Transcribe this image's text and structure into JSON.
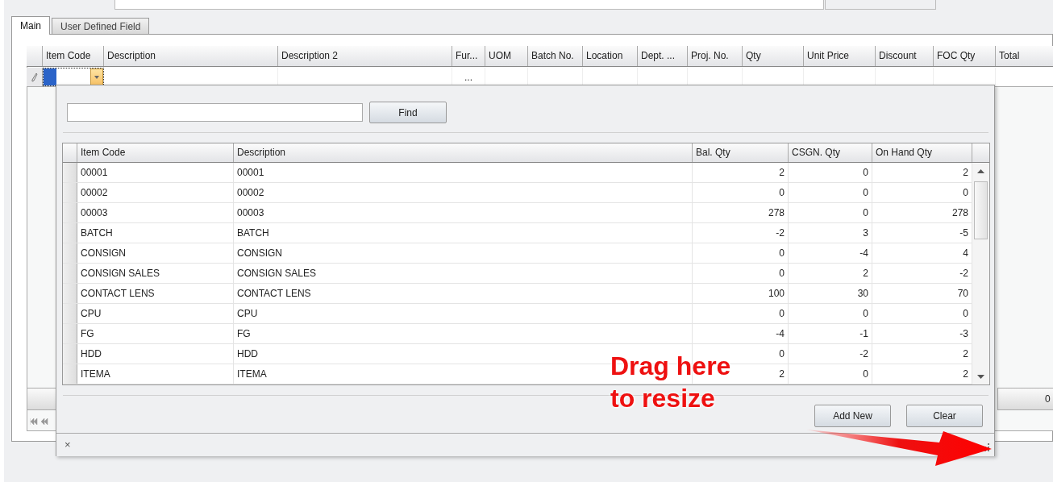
{
  "tabs": [
    {
      "label": "Main",
      "selected": true
    },
    {
      "label": "User Defined Field",
      "selected": false
    }
  ],
  "grid": {
    "columns": [
      "Item Code",
      "Description",
      "Description 2",
      "Fur...",
      "UOM",
      "Batch No.",
      "Location",
      "Dept. ...",
      "Proj. No.",
      "Qty",
      "Unit Price",
      "Discount",
      "FOC Qty",
      "Total"
    ],
    "edit_row": {
      "further_button": "..."
    },
    "side_button": "0"
  },
  "lookup": {
    "find_button": "Find",
    "columns": [
      "Item Code",
      "Description",
      "Bal. Qty",
      "CSGN. Qty",
      "On Hand Qty"
    ],
    "rows": [
      [
        "00001",
        "00001",
        "2",
        "0",
        "2"
      ],
      [
        "00002",
        "00002",
        "0",
        "0",
        "0"
      ],
      [
        "00003",
        "00003",
        "278",
        "0",
        "278"
      ],
      [
        "BATCH",
        "BATCH",
        "-2",
        "3",
        "-5"
      ],
      [
        "CONSIGN",
        "CONSIGN",
        "0",
        "-4",
        "4"
      ],
      [
        "CONSIGN SALES",
        "CONSIGN SALES",
        "0",
        "2",
        "-2"
      ],
      [
        "CONTACT LENS",
        "CONTACT LENS",
        "100",
        "30",
        "70"
      ],
      [
        "CPU",
        "CPU",
        "0",
        "0",
        "0"
      ],
      [
        "FG",
        "FG",
        "-4",
        "-1",
        "-3"
      ],
      [
        "HDD",
        "HDD",
        "0",
        "-2",
        "2"
      ],
      [
        "ITEMA",
        "ITEMA",
        "2",
        "0",
        "2"
      ]
    ],
    "buttons": [
      "Add New",
      "Clear"
    ],
    "close": "×"
  },
  "annotation": {
    "lines": [
      "Drag here",
      "to resize"
    ]
  }
}
